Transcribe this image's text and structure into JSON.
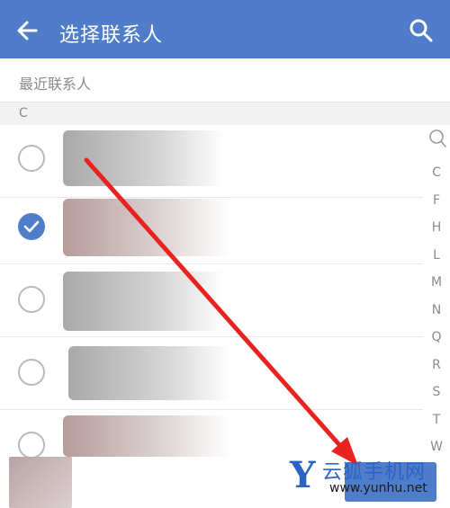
{
  "header": {
    "title": "选择联系人",
    "back_icon": "arrow-left-icon",
    "search_icon": "search-icon"
  },
  "recent_contacts_label": "最近联系人",
  "section_letter": "C",
  "contacts": [
    {
      "checked": false
    },
    {
      "checked": true
    },
    {
      "checked": false
    },
    {
      "checked": false
    },
    {
      "checked": false
    }
  ],
  "index_bar": {
    "icon": "search-icon",
    "letters": [
      "C",
      "F",
      "H",
      "L",
      "M",
      "N",
      "Q",
      "R",
      "S",
      "T",
      "W"
    ]
  },
  "watermark": {
    "logo_letter": "Y",
    "name": "云狐手机网",
    "url": "www.yunhu.net"
  },
  "colors": {
    "accent": "#4f7dc9",
    "annotation_arrow": "#e8231f"
  }
}
